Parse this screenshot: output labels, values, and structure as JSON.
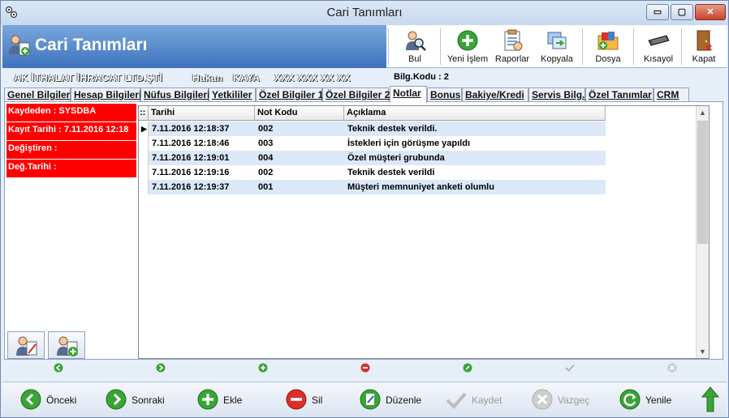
{
  "window": {
    "title": "Cari Tanımları",
    "minimize": "▭",
    "maximize": "▢",
    "close": "✕"
  },
  "header": {
    "title": "Cari Tanımları",
    "tools": [
      {
        "label": "Bul",
        "icon": "search-user-icon"
      },
      {
        "label": "Yeni İşlem",
        "icon": "add-icon"
      },
      {
        "label": "Raporlar",
        "icon": "report-icon"
      },
      {
        "label": "Kopyala",
        "icon": "copy-icon"
      },
      {
        "label": "Dosya",
        "icon": "folder-icon"
      },
      {
        "label": "Kısayol",
        "icon": "keyboard-icon"
      },
      {
        "label": "Kapat",
        "icon": "exit-icon"
      }
    ]
  },
  "info": {
    "company": "AK İTHALAT İHRACAT LTD.ŞTİ",
    "first_name": "Hakan",
    "last_name": "KAYA",
    "phone": "XXX XXX XX XX",
    "code": "Bilg.Kodu : 2"
  },
  "tabs": [
    {
      "label": "Genel Bilgiler"
    },
    {
      "label": "Hesap Bilgileri"
    },
    {
      "label": "Nüfus Bilgileri"
    },
    {
      "label": "Yetkililer"
    },
    {
      "label": "Özel Bilgiler 1"
    },
    {
      "label": "Özel Bilgiler 2"
    },
    {
      "label": "Notlar"
    },
    {
      "label": "Bonus"
    },
    {
      "label": "Bakiye/Kredi"
    },
    {
      "label": "Servis Bilg."
    },
    {
      "label": "Özel Tanımlar"
    },
    {
      "label": "CRM"
    }
  ],
  "audit": {
    "created_by": "Kaydeden : SYSDBA",
    "created_at": "Kayıt Tarihi : 7.11.2016 12:18",
    "modified_by": "Değiştiren :",
    "modified_at": "Değ.Tarihi :"
  },
  "grid": {
    "corner": "::",
    "columns": [
      "Tarihi",
      "Not Kodu",
      "Açıklama"
    ],
    "rows": [
      {
        "date": "7.11.2016 12:18:37",
        "code": "002",
        "desc": "Teknik destek verildi."
      },
      {
        "date": "7.11.2016 12:18:46",
        "code": "003",
        "desc": "İstekleri için görüşme yapıldı"
      },
      {
        "date": "7.11.2016 12:19:01",
        "code": "004",
        "desc": "Özel müşteri grubunda"
      },
      {
        "date": "7.11.2016 12:19:16",
        "code": "002",
        "desc": "Teknik destek verildi"
      },
      {
        "date": "7.11.2016 12:19:37",
        "code": "001",
        "desc": "Müşteri memnuniyet anketi olumlu"
      }
    ],
    "selected_marker": "▶"
  },
  "bottom": {
    "prev": "Önceki",
    "next": "Sonraki",
    "add": "Ekle",
    "delete": "Sil",
    "edit": "Düzenle",
    "save": "Kaydet",
    "cancel": "Vazgeç",
    "refresh": "Yenile"
  },
  "colors": {
    "accent": "#3d73bd",
    "alert": "#ff0000",
    "row_alt": "#dbe8f8",
    "green": "#3aa437",
    "red": "#d9302b"
  }
}
